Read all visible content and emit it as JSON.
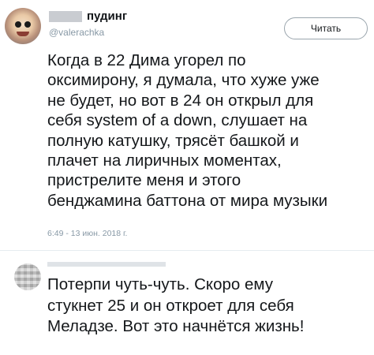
{
  "tweet": {
    "author": {
      "display_name": "пудинг",
      "handle": "@valerachka"
    },
    "follow_button_label": "Читать",
    "text_lines": [
      "Когда в 22 Дима угорел по",
      "оксимирону, я думала, что хуже уже",
      "не будет, но вот в 24 он открыл для",
      "себя system of a down, слушает на",
      "полную катушку, трясёт башкой и",
      "плачет на лиричных моментах,",
      "пристрелите меня и этого",
      "бенджамина баттона от мира музыки"
    ],
    "timestamp": "6:49 - 13 июн. 2018 г."
  },
  "reply": {
    "text_lines": [
      "Потерпи чуть-чуть. Скоро ему",
      "стукнет 25 и он откроет для себя",
      "Меладзе. Вот это начнётся жизнь!"
    ]
  }
}
